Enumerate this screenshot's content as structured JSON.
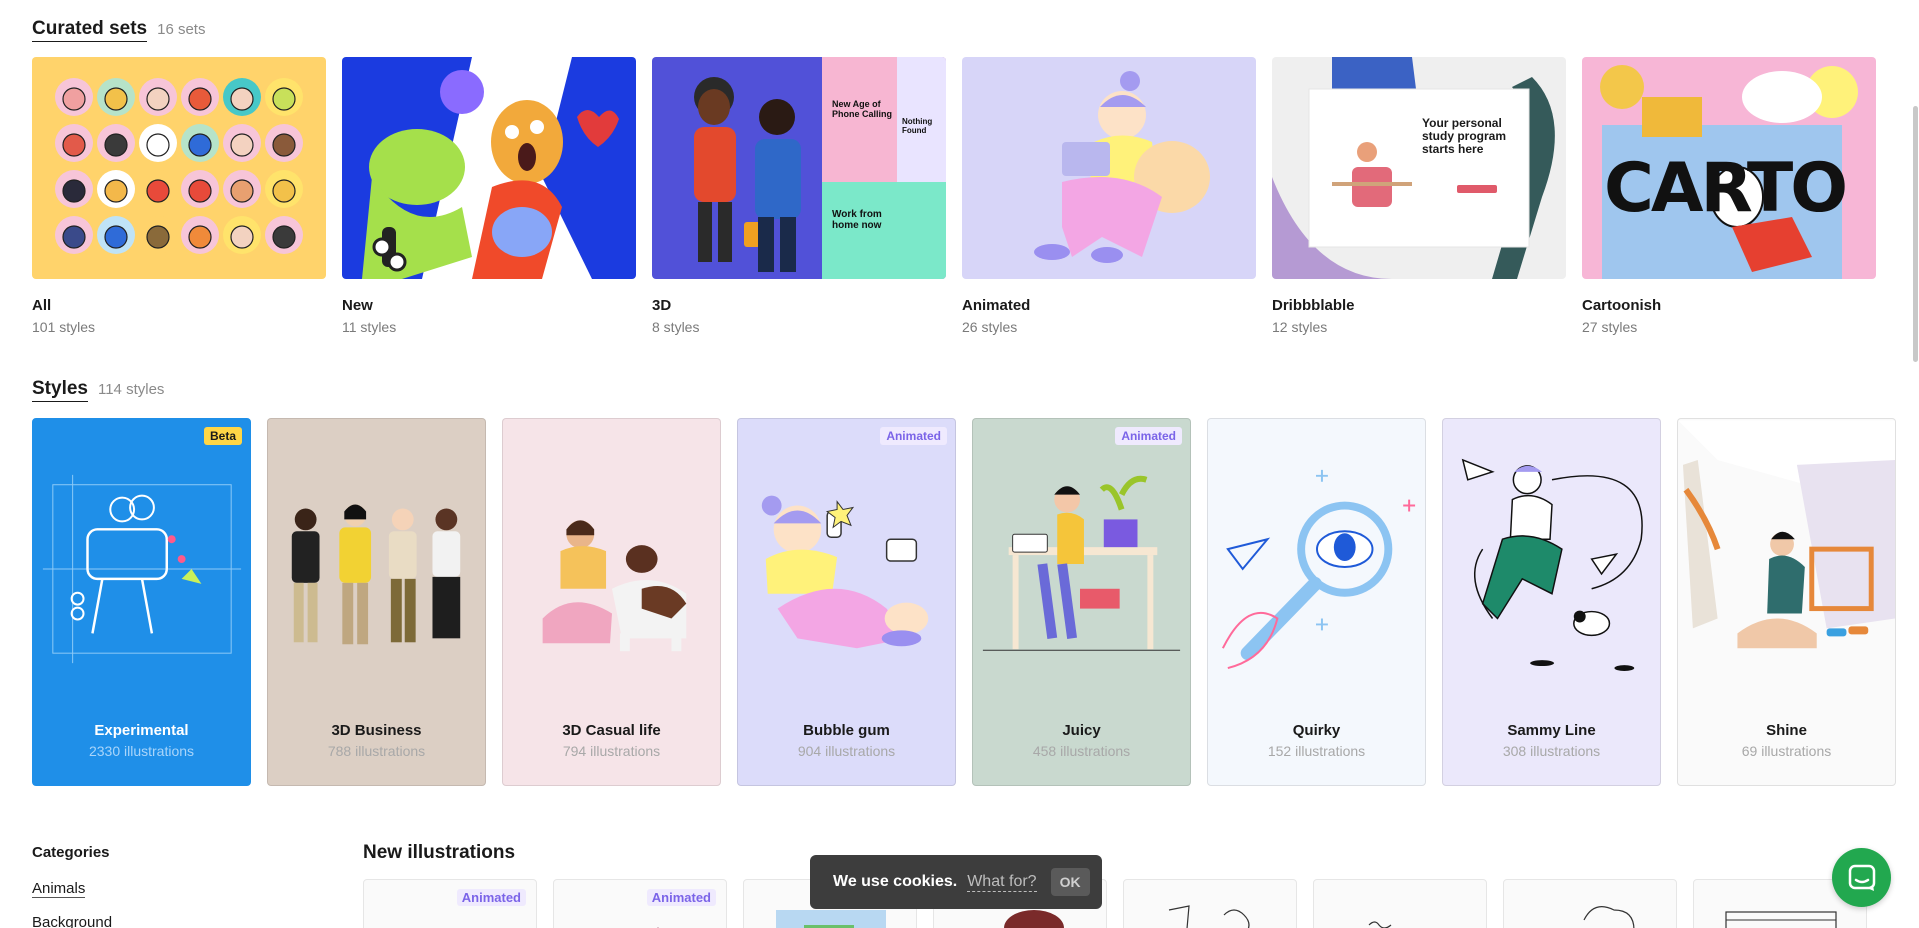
{
  "curated": {
    "title": "Curated sets",
    "count": "16 sets",
    "cards": [
      {
        "name": "All",
        "count": "101 styles"
      },
      {
        "name": "New",
        "count": "11 styles"
      },
      {
        "name": "3D",
        "count": "8 styles"
      },
      {
        "name": "Animated",
        "count": "26 styles"
      },
      {
        "name": "Dribbblable",
        "count": "12 styles"
      },
      {
        "name": "Cartoonish",
        "count": "27 styles"
      }
    ],
    "thumb_texts": {
      "phone_calling": "New Age of Phone Calling",
      "not_found": "Nothing Found",
      "work_from_home": "Work from home now",
      "study_program": "Your personal study program starts here",
      "carto": "CARTO"
    }
  },
  "styles": {
    "title": "Styles",
    "count": "114 styles",
    "cards": [
      {
        "name": "Experimental",
        "count": "2330 illustrations",
        "badge": "Beta"
      },
      {
        "name": "3D Business",
        "count": "788 illustrations"
      },
      {
        "name": "3D Casual life",
        "count": "794 illustrations"
      },
      {
        "name": "Bubble gum",
        "count": "904 illustrations",
        "badge": "Animated"
      },
      {
        "name": "Juicy",
        "count": "458 illustrations",
        "badge": "Animated"
      },
      {
        "name": "Quirky",
        "count": "152 illustrations"
      },
      {
        "name": "Sammy Line",
        "count": "308 illustrations"
      },
      {
        "name": "Shine",
        "count": "69 illustrations"
      }
    ]
  },
  "categories": {
    "title": "Categories",
    "items": [
      "Animals",
      "Background"
    ]
  },
  "new_illustrations": {
    "title": "New illustrations",
    "badges": [
      "Animated",
      "Animated"
    ]
  },
  "cookie": {
    "text": "We use cookies.",
    "link": "What for?",
    "ok": "OK"
  },
  "colors": {
    "experimental_bg": "#1f8fe8",
    "beta_badge": "#ffd646",
    "animated_badge_text": "#7b64e8",
    "chat_green": "#22a84f"
  },
  "icons": [
    "chat-icon"
  ]
}
